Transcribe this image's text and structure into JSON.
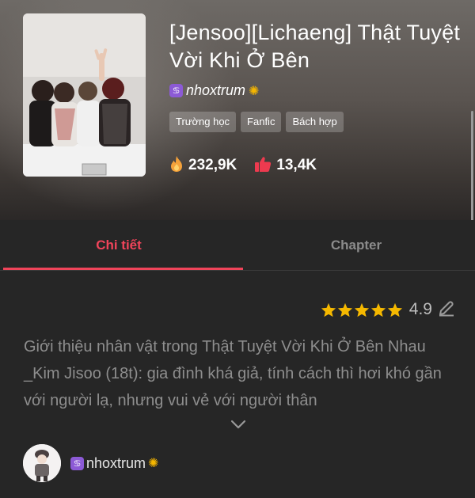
{
  "story": {
    "title": "[Jensoo][Lichaeng] Thật Tuyệt Vời Khi Ở Bên",
    "author": {
      "name": "nhoxtrum",
      "prefix_icon": "cancer-zodiac-icon",
      "suffix_icon": "sunflower-icon"
    },
    "tags": [
      "Trường học",
      "Fanfic",
      "Bách hợp"
    ],
    "stats": {
      "views": "232,9K",
      "views_icon": "fire-icon",
      "likes": "13,4K",
      "likes_icon": "thumbs-up-icon"
    }
  },
  "tabs": [
    {
      "label": "Chi tiết",
      "active": true
    },
    {
      "label": "Chapter",
      "active": false
    }
  ],
  "detail": {
    "rating": "4.9",
    "stars": 5,
    "rating_edit_icon": "pencil-icon",
    "description": "Giới thiệu nhân vật trong Thật Tuyệt Vời Khi Ở Bên Nhau _Kim Jisoo (18t): gia đình khá giả, tính cách thì hơi khó gần với người lạ, nhưng vui vẻ với người thân",
    "expand_icon": "chevron-down-icon"
  },
  "footer_author": {
    "name": "nhoxtrum"
  },
  "colors": {
    "accent": "#f0445a",
    "star": "#f5b800",
    "background": "#262626"
  }
}
